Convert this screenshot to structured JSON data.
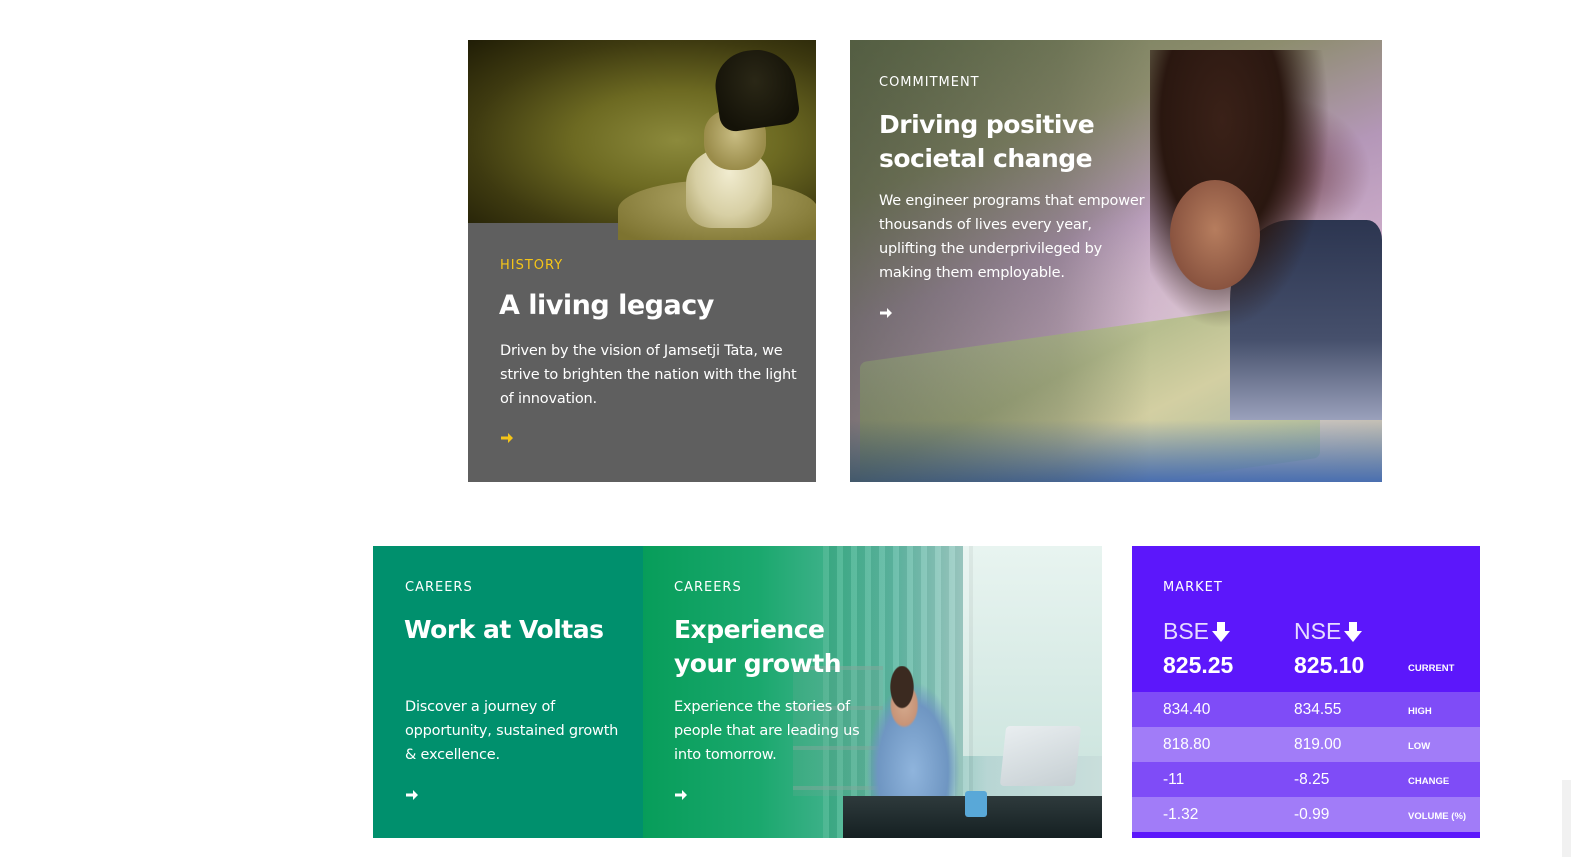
{
  "history": {
    "tag": "HISTORY",
    "title": "A living legacy",
    "description": "Driven by the vision of Jamsetji Tata, we strive to brighten the nation with the light of innovation.",
    "tag_color": "#f5c518",
    "arrow_color": "#f5c518",
    "background": "#5f5f5f"
  },
  "commitment": {
    "tag": "COMMITMENT",
    "title": "Driving positive societal change",
    "description": "We engineer programs that empower thousands of lives every year, uplifting the underprivileged by making them employable."
  },
  "careers_primary": {
    "tag": "CAREERS",
    "title": "Work at Voltas",
    "description": "Discover a journey of opportunity, sustained growth & excellence.",
    "background": "#00906d"
  },
  "careers_secondary": {
    "tag": "CAREERS",
    "title": "Experience your growth",
    "description": "Experience the stories of people that are leading us into tomorrow."
  },
  "market": {
    "tag": "MARKET",
    "background": "#5c17fb",
    "exchanges": [
      {
        "name": "BSE",
        "trend_icon": "arrow-down-icon",
        "current": "825.25",
        "high": "834.40",
        "low": "818.80",
        "change": "-11",
        "volume_pct": "-1.32"
      },
      {
        "name": "NSE",
        "trend_icon": "arrow-down-icon",
        "current": "825.10",
        "high": "834.55",
        "low": "819.00",
        "change": "-8.25",
        "volume_pct": "-0.99"
      }
    ],
    "labels": {
      "current": "CURRENT",
      "high": "HIGH",
      "low": "LOW",
      "change": "CHANGE",
      "volume": "VOLUME (%)"
    }
  }
}
